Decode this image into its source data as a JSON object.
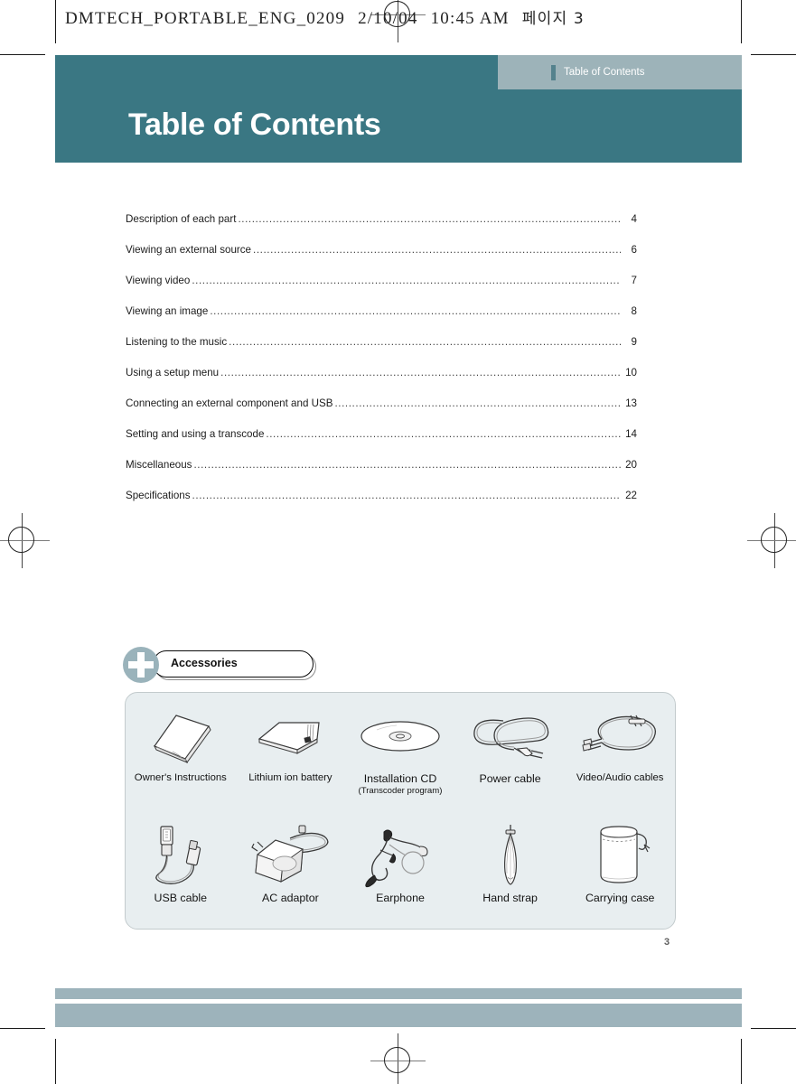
{
  "film_header": {
    "filename": "DMTECH_PORTABLE_ENG_0209",
    "date": "2/10/04",
    "time": "10:45 AM",
    "page_label": "페이지 3"
  },
  "banner": {
    "tab_label": "Table of Contents",
    "title": "Table of Contents"
  },
  "toc": {
    "entries": [
      {
        "label": "Description of each part",
        "page": "4"
      },
      {
        "label": "Viewing an external source",
        "page": "6"
      },
      {
        "label": "Viewing video ",
        "page": "7"
      },
      {
        "label": "Viewing an image ",
        "page": "8"
      },
      {
        "label": "Listening to the music ",
        "page": "9"
      },
      {
        "label": "Using a setup menu  ",
        "page": "10"
      },
      {
        "label": "Connecting an external component and USB ",
        "page": "13"
      },
      {
        "label": "Setting and using a transcode ",
        "page": "14"
      },
      {
        "label": "Miscellaneous ",
        "page": "20"
      },
      {
        "label": "Specifications  ",
        "page": "22"
      }
    ]
  },
  "accessories": {
    "badge_label": "Accessories",
    "items": [
      {
        "label": "Owner's Instructions",
        "sub": "",
        "icon": "manual-booklet-icon"
      },
      {
        "label": "Lithium ion battery",
        "sub": "",
        "icon": "battery-pack-icon"
      },
      {
        "label": "Installation CD",
        "sub": "(Transcoder program)",
        "icon": "compact-disc-icon"
      },
      {
        "label": "Power cable",
        "sub": "",
        "icon": "power-cable-icon"
      },
      {
        "label": "Video/Audio cables",
        "sub": "",
        "icon": "av-cable-icon"
      },
      {
        "label": "USB cable",
        "sub": "",
        "icon": "usb-cable-icon"
      },
      {
        "label": "AC adaptor",
        "sub": "",
        "icon": "ac-adaptor-icon"
      },
      {
        "label": "Earphone",
        "sub": "",
        "icon": "earphone-icon"
      },
      {
        "label": "Hand strap",
        "sub": "",
        "icon": "hand-strap-icon"
      },
      {
        "label": "Carrying case",
        "sub": "",
        "icon": "carrying-pouch-icon"
      }
    ]
  },
  "footer": {
    "page_number": "3"
  },
  "colors": {
    "banner_teal": "#3a7783",
    "banner_tab_gray": "#9db3b9",
    "footer_band": "#9db3bb",
    "panel_bg": "#e8eef0",
    "badge_circle": "#9ab3bb"
  }
}
